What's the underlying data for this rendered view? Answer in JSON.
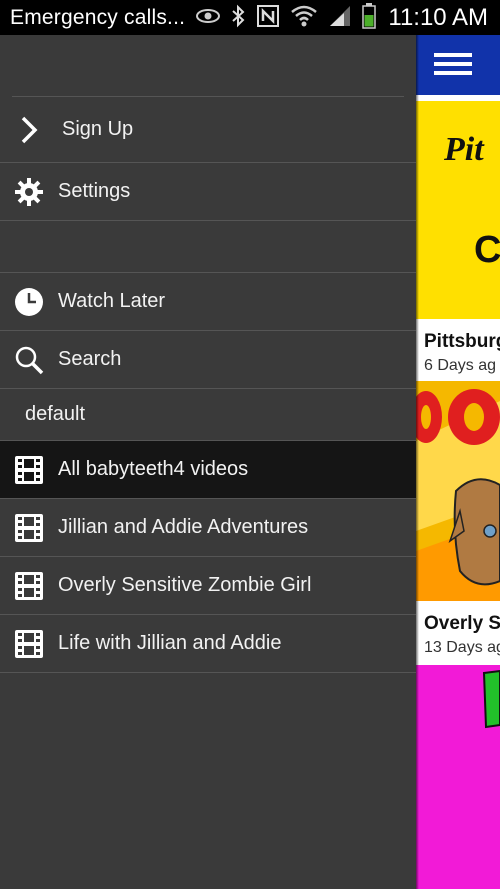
{
  "status_bar": {
    "carrier": "Emergency calls...",
    "time": "11:10 AM",
    "icons": [
      "eye-icon",
      "bluetooth-icon",
      "nfc-icon",
      "wifi-icon",
      "signal-icon",
      "battery-icon"
    ]
  },
  "drawer": {
    "sign_up": "Sign Up",
    "settings": "Settings",
    "watch_later": "Watch Later",
    "search": "Search",
    "section_header": "default",
    "playlists": [
      {
        "label": "All babyteeth4 videos",
        "active": true
      },
      {
        "label": "Jillian and Addie Adventures",
        "active": false
      },
      {
        "label": "Overly Sensitive Zombie Girl",
        "active": false
      },
      {
        "label": "Life with Jillian and Addie",
        "active": false
      }
    ]
  },
  "content": {
    "app_bar_color": "#1133aa",
    "videos": [
      {
        "title": "Pittsburg",
        "age": "6 Days ag",
        "thumb_text_1": "Pit",
        "thumb_text_2": "C",
        "thumb_color": "#ffe000"
      },
      {
        "title": "Overly S",
        "age": "13 Days ag",
        "thumb_color": "#f2c200"
      },
      {
        "thumb_color": "#f21ad7"
      }
    ]
  }
}
